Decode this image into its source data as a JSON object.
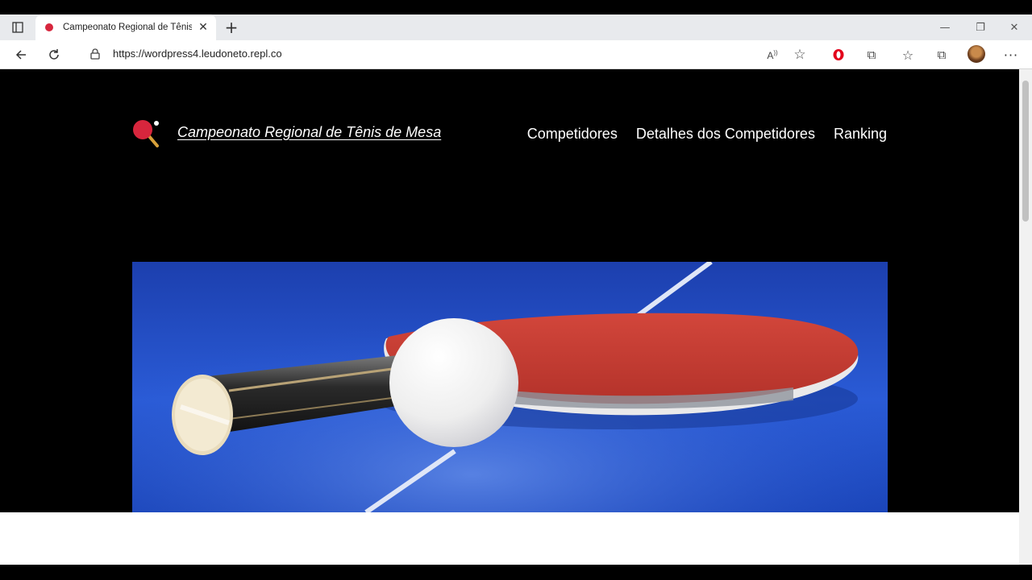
{
  "browser": {
    "tab_title": "Campeonato Regional de Tênis de Mesa",
    "url": "https://wordpress4.leudoneto.repl.co"
  },
  "site": {
    "title": "Campeonato Regional de Tênis de Mesa",
    "nav": [
      {
        "label": "Competidores"
      },
      {
        "label": "Detalhes dos Competidores"
      },
      {
        "label": "Ranking"
      }
    ]
  },
  "colors": {
    "logo_red": "#d7263d",
    "page_bg": "#000000",
    "table_blue": "#1f4fc4"
  },
  "hero": {
    "subject": "table tennis paddle and ball"
  }
}
